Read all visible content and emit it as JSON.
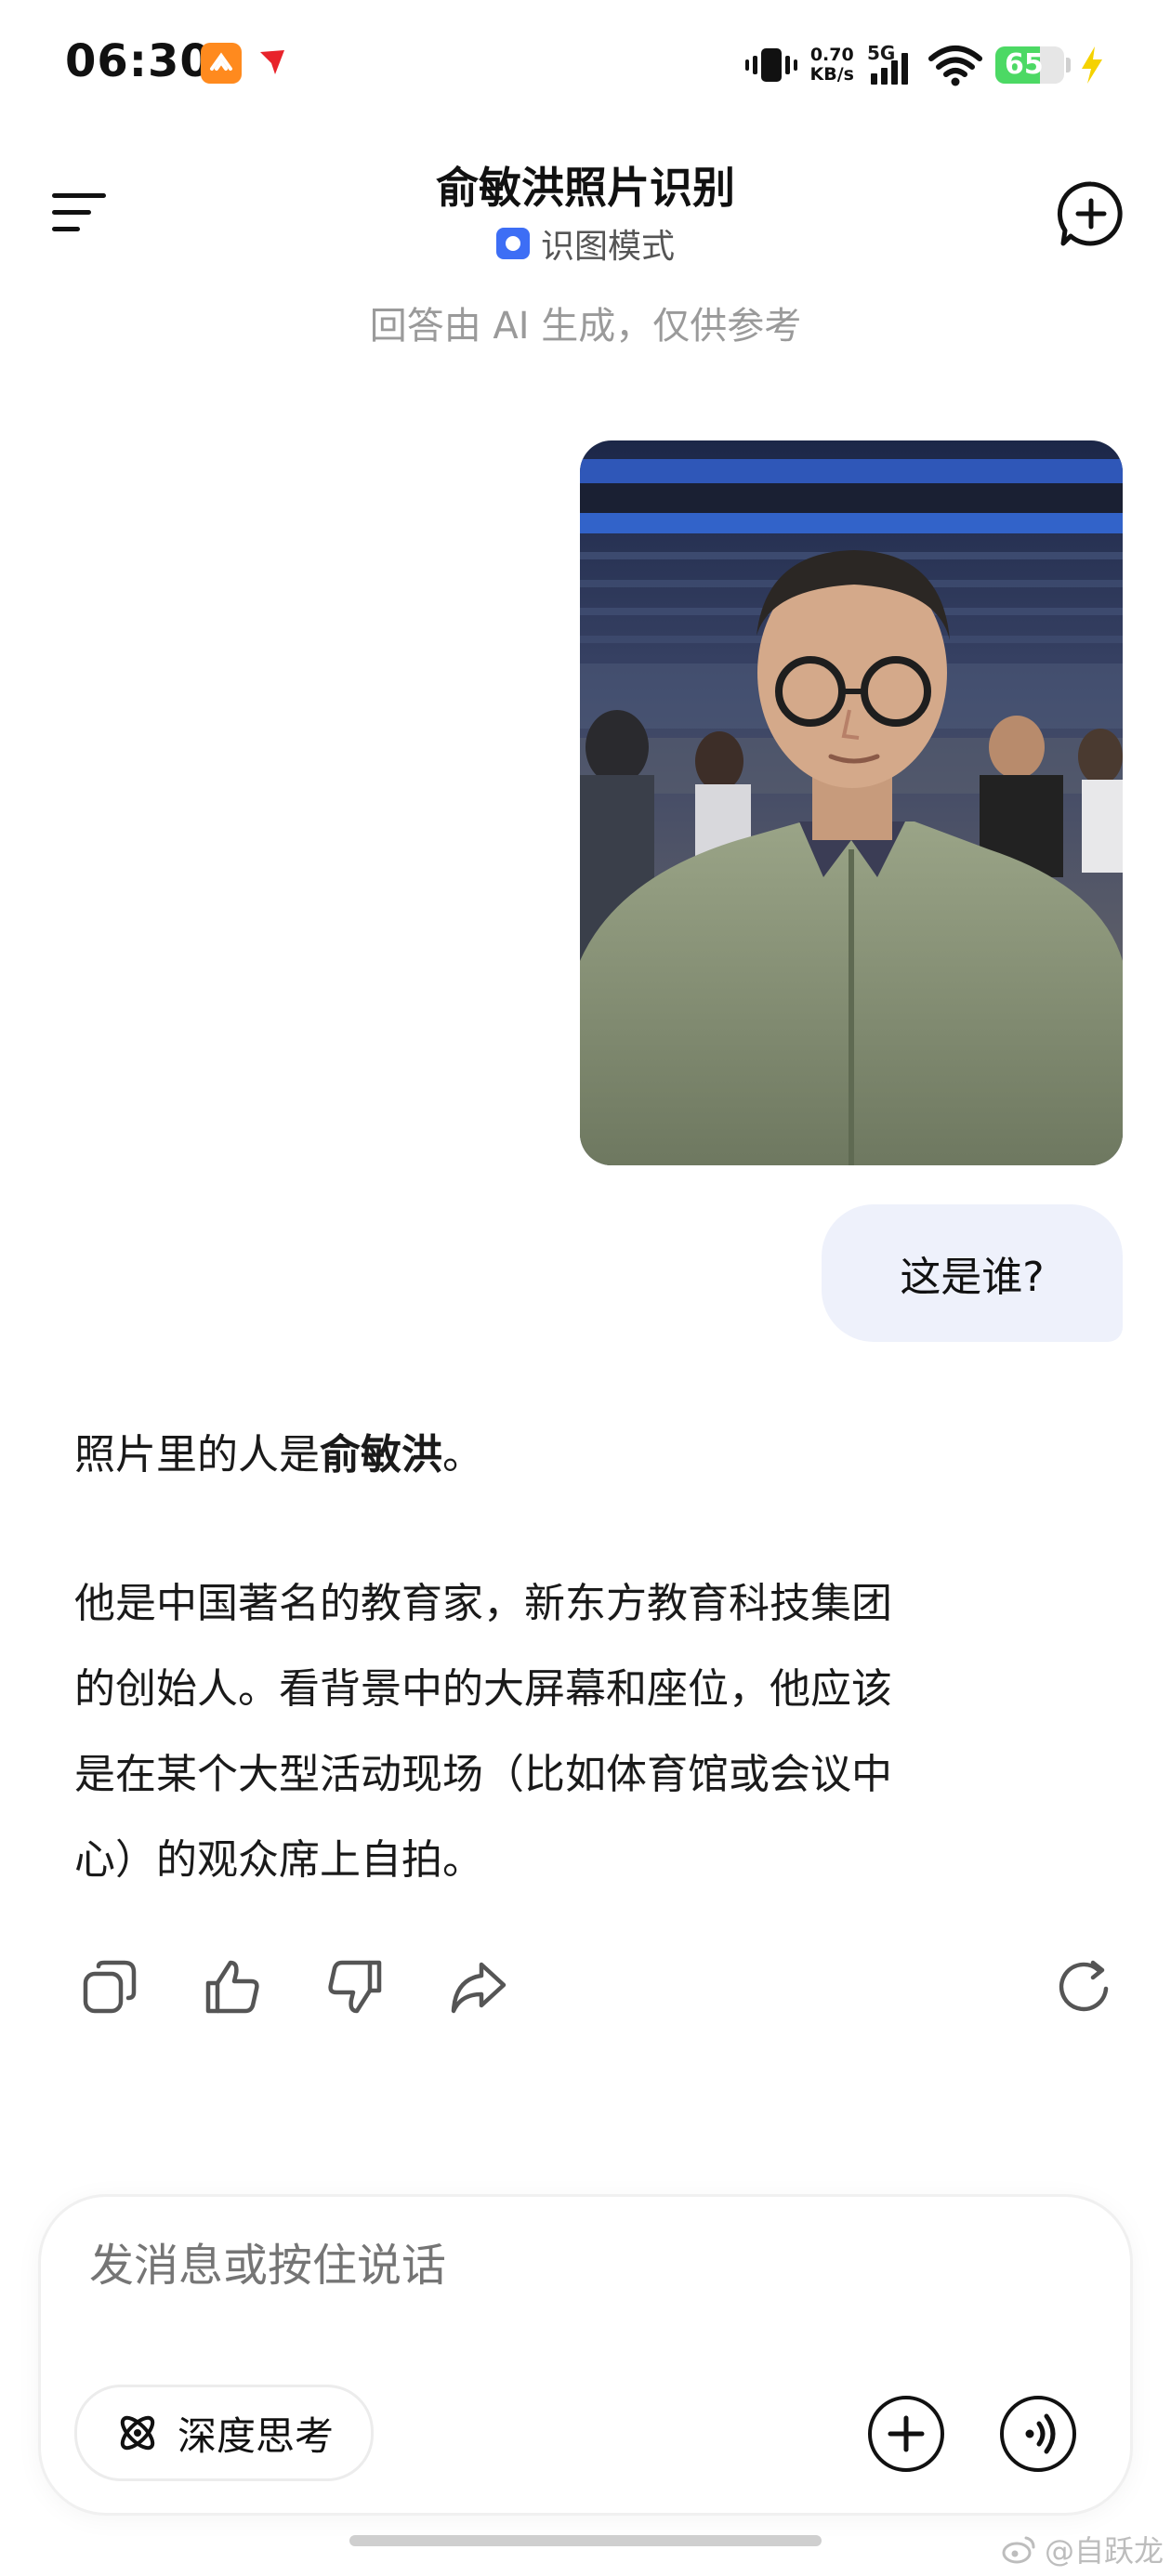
{
  "status_bar": {
    "time": "06:30",
    "speed_value": "0.70",
    "speed_unit": "KB/s",
    "network": "5G",
    "battery": "65",
    "battery_level": 0.65
  },
  "header": {
    "title": "俞敏洪照片识别",
    "mode_label": "识图模式",
    "disclaimer": "回答由 AI 生成，仅供参考"
  },
  "chat": {
    "user_question": "这是谁?",
    "answer_prefix": "照片里的人是",
    "answer_name": "俞敏洪",
    "answer_suffix": "。",
    "answer_lines": [
      "他是中国著名的教育家，新东方教育科技集团",
      "的创始人。看背景中的大屏幕和座位，他应该",
      "是在某个大型活动现场（比如体育馆或会议中",
      "心）的观众席上自拍。"
    ]
  },
  "actions": [
    "copy-icon",
    "thumbs-up-icon",
    "thumbs-down-icon",
    "share-icon",
    "regenerate-icon"
  ],
  "composer": {
    "placeholder": "发消息或按住说话",
    "deep_think_label": "深度思考"
  },
  "watermark": "@自跃龙",
  "colors": {
    "accent": "#3d6ef5",
    "bubble": "#eef1fb",
    "battery": "#4cd964",
    "app_icon": "#ff8a1e"
  }
}
